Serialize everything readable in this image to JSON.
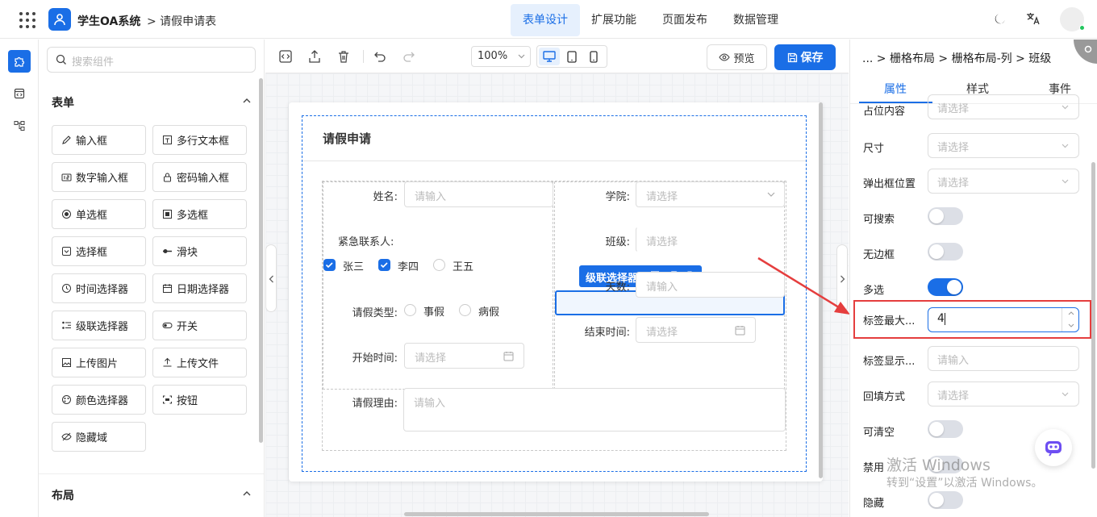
{
  "header": {
    "app_name": "学生OA系统",
    "breadcrumb": "> 请假申请表",
    "nav": [
      "表单设计",
      "扩展功能",
      "页面发布",
      "数据管理"
    ],
    "active_nav": "表单设计"
  },
  "components": {
    "search_placeholder": "搜索组件",
    "section_form": "表单",
    "section_layout": "布局",
    "items": [
      {
        "label": "输入框",
        "icon": "edit-icon"
      },
      {
        "label": "多行文本框",
        "icon": "textarea-icon"
      },
      {
        "label": "数字输入框",
        "icon": "number-icon"
      },
      {
        "label": "密码输入框",
        "icon": "lock-icon"
      },
      {
        "label": "单选框",
        "icon": "radio-icon"
      },
      {
        "label": "多选框",
        "icon": "checkbox-icon"
      },
      {
        "label": "选择框",
        "icon": "select-icon"
      },
      {
        "label": "滑块",
        "icon": "slider-icon"
      },
      {
        "label": "时间选择器",
        "icon": "clock-icon"
      },
      {
        "label": "日期选择器",
        "icon": "calendar-icon"
      },
      {
        "label": "级联选择器",
        "icon": "cascader-icon"
      },
      {
        "label": "开关",
        "icon": "toggle-icon"
      },
      {
        "label": "上传图片",
        "icon": "image-icon"
      },
      {
        "label": "上传文件",
        "icon": "upload-icon"
      },
      {
        "label": "颜色选择器",
        "icon": "palette-icon"
      },
      {
        "label": "按钮",
        "icon": "button-icon"
      },
      {
        "label": "隐藏域",
        "icon": "eye-off-icon"
      }
    ]
  },
  "toolbar": {
    "zoom": "100%",
    "preview_label": "预览",
    "save_label": "保存"
  },
  "form": {
    "title": "请假申请",
    "name_label": "姓名:",
    "name_placeholder": "请输入",
    "college_label": "学院:",
    "college_placeholder": "请选择",
    "class_label": "班级:",
    "class_placeholder": "请选择",
    "contact_label": "紧急联系人:",
    "contacts": [
      {
        "label": "张三",
        "checked": true
      },
      {
        "label": "李四",
        "checked": true
      },
      {
        "label": "王五",
        "checked": false
      }
    ],
    "days_label": "天数:",
    "days_placeholder": "请输入",
    "leave_type_label": "请假类型:",
    "leave_types": [
      "事假",
      "病假"
    ],
    "end_label": "结束时间:",
    "end_placeholder": "请选择",
    "start_label": "开始时间:",
    "start_placeholder": "请选择",
    "reason_label": "请假理由:",
    "reason_placeholder": "请输入",
    "selected_component_label": "级联选择器"
  },
  "properties": {
    "breadcrumb": "... > 栅格布局 > 栅格布局-列 > 班级",
    "tabs": [
      "属性",
      "样式",
      "事件"
    ],
    "active_tab": "属性",
    "rows": [
      {
        "label": "占位内容",
        "type": "select",
        "placeholder": "请选择"
      },
      {
        "label": "尺寸",
        "type": "select",
        "placeholder": "请选择"
      },
      {
        "label": "弹出框位置",
        "type": "select",
        "placeholder": "请选择"
      },
      {
        "label": "可搜索",
        "type": "toggle",
        "on": false
      },
      {
        "label": "无边框",
        "type": "toggle",
        "on": false
      },
      {
        "label": "多选",
        "type": "toggle",
        "on": true
      },
      {
        "label": "标签最大...",
        "type": "number",
        "value": "4"
      },
      {
        "label": "标签显示...",
        "type": "input",
        "placeholder": "请输入"
      },
      {
        "label": "回填方式",
        "type": "select",
        "placeholder": "请选择"
      },
      {
        "label": "可清空",
        "type": "toggle",
        "on": false
      },
      {
        "label": "禁用",
        "type": "toggle",
        "on": false
      },
      {
        "label": "隐藏",
        "type": "toggle",
        "on": false
      }
    ]
  },
  "watermark": {
    "line1": "激活 Windows",
    "line2": "转到“设置”以激活 Windows。"
  },
  "colors": {
    "accent": "#1a6ee6",
    "highlight": "#e53e3e"
  }
}
